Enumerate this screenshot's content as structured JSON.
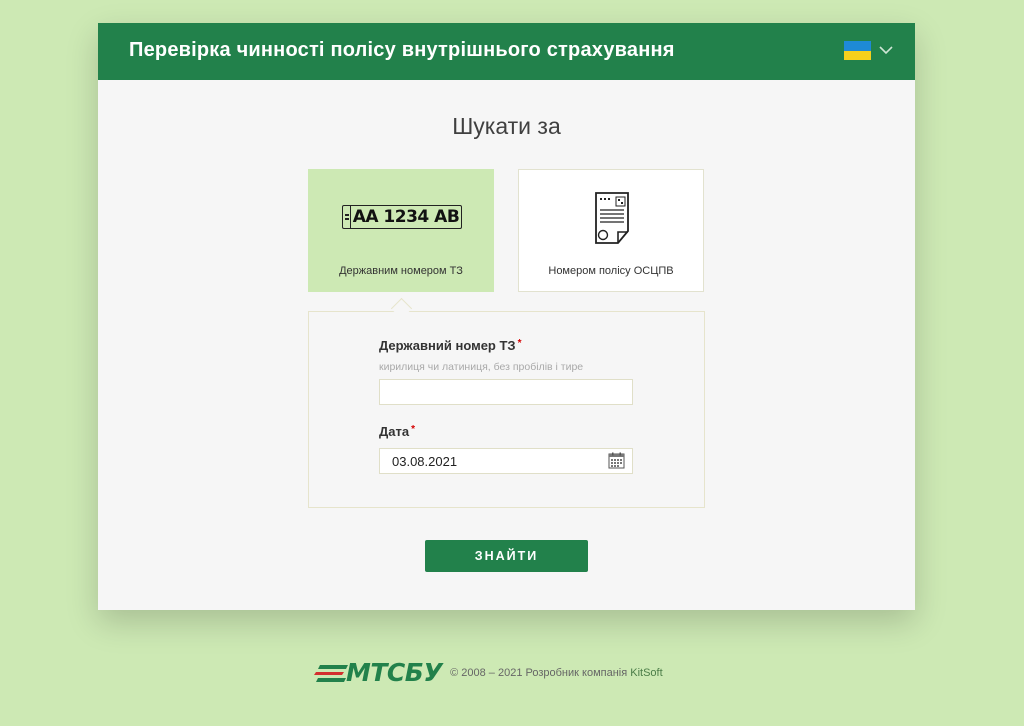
{
  "header": {
    "title": "Перевірка чинності полісу внутрішнього страхування",
    "language_flag": "ukraine-flag-icon"
  },
  "search": {
    "title": "Шукати за",
    "options": [
      {
        "label": "Державним номером ТЗ",
        "icon": "license-plate-icon",
        "plate_text": "AA 1234 AB",
        "active": true
      },
      {
        "label": "Номером полісу ОСЦПВ",
        "icon": "document-icon",
        "active": false
      }
    ]
  },
  "form": {
    "plate_label": "Державний номер ТЗ",
    "plate_hint": "кирилиця чи латиниця, без пробілів і тире",
    "plate_value": "",
    "date_label": "Дата",
    "date_value": "03.08.2021",
    "required_mark": "*"
  },
  "submit_label": "ЗНАЙТИ",
  "footer": {
    "logo_text": "МТСБУ",
    "copyright": "© 2008 – 2021 Розробник компанія ",
    "developer": "KitSoft"
  },
  "colors": {
    "brand_green": "#22814b",
    "page_bg": "#cde9b4",
    "active_option": "#cde9b4",
    "logo_red": "#d32f2f"
  }
}
